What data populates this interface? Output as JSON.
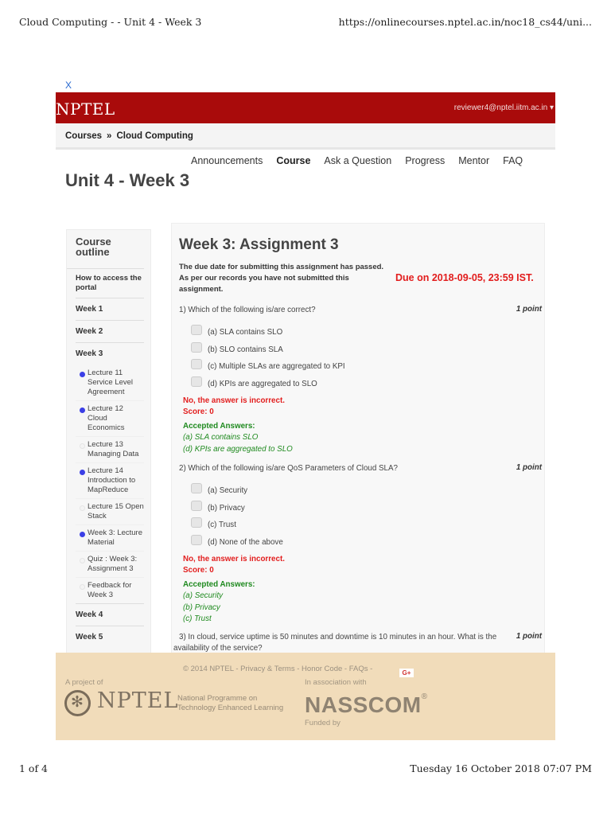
{
  "print": {
    "page_title": "Cloud Computing - - Unit 4 - Week 3",
    "url": "https://onlinecourses.nptel.ac.in/noc18_cs44/uni...",
    "page_count": "1 of 4",
    "printed_at": "Tuesday 16 October 2018 07:07 PM"
  },
  "close_label": "X",
  "topbar": {
    "logo": "NPTEL",
    "user": "reviewer4@nptel.iitm.ac.in ▾",
    "color": "#a90b0b"
  },
  "breadcrumb": {
    "items": [
      "Courses",
      "Cloud Computing"
    ],
    "separator": "»"
  },
  "nav": {
    "items": [
      {
        "label": "Announcements",
        "active": false
      },
      {
        "label": "Course",
        "active": true
      },
      {
        "label": "Ask a Question",
        "active": false
      },
      {
        "label": "Progress",
        "active": false
      },
      {
        "label": "Mentor",
        "active": false
      },
      {
        "label": "FAQ",
        "active": false
      }
    ]
  },
  "unit_title": "Unit 4 - Week 3",
  "sidebar": {
    "title_line1": "Course",
    "title_line2": "outline",
    "intro": "How to access the portal",
    "weeks_before": [
      "Week 1",
      "Week 2",
      "Week 3"
    ],
    "week3_items": [
      {
        "label": "Lecture 11 Service Level Agreement",
        "status": "done"
      },
      {
        "label": "Lecture 12 Cloud Economics",
        "status": "done"
      },
      {
        "label": "Lecture 13 Managing Data",
        "status": "pending"
      },
      {
        "label": "Lecture 14 Introduction to MapReduce",
        "status": "done"
      },
      {
        "label": "Lecture 15 Open Stack",
        "status": "pending"
      },
      {
        "label": "Week 3: Lecture Material",
        "status": "done"
      },
      {
        "label": "Quiz : Week 3: Assignment 3",
        "status": "pending"
      },
      {
        "label": "Feedback for Week 3",
        "status": "pending"
      }
    ],
    "weeks_after": [
      "Week 4",
      "Week 5"
    ]
  },
  "assignment": {
    "title": "Week 3: Assignment 3",
    "notice_line1": "The due date for submitting this assignment has passed.",
    "notice_line2": "As per our records you have not submitted this assignment.",
    "due": "Due on 2018-09-05, 23:59 IST.",
    "questions": [
      {
        "text": "1) Which of the following is/are correct?",
        "points": "1 point",
        "options": [
          "(a) SLA contains SLO",
          "(b) SLO contains SLA",
          "(c) Multiple SLAs are aggregated to KPI",
          "(d) KPIs are aggregated to SLO"
        ],
        "result": "No, the answer is incorrect.",
        "score": "Score: 0",
        "accepted_label": "Accepted Answers:",
        "accepted": [
          "(a) SLA contains SLO",
          "(d) KPIs are aggregated to SLO"
        ]
      },
      {
        "text": "2) Which of the following is/are QoS Parameters of Cloud SLA?",
        "points": "1 point",
        "options": [
          "(a) Security",
          "(b) Privacy",
          "(c) Trust",
          "(d) None of the above"
        ],
        "result": "No, the answer is incorrect.",
        "score": "Score: 0",
        "accepted_label": "Accepted Answers:",
        "accepted": [
          "(a) Security",
          "(b) Privacy",
          "(c) Trust"
        ]
      },
      {
        "text": "3) In cloud, service uptime is 50 minutes and downtime is 10 minutes in an hour. What is the availability of the service?",
        "points": "1 point"
      }
    ]
  },
  "footer": {
    "links": [
      "© 2014 NPTEL",
      "Privacy & Terms",
      "Honor Code",
      "FAQs"
    ],
    "gplus": "G+",
    "project_of": "A project of",
    "nptel_word": "NPTEL",
    "nptel_full": "National Programme on Technology Enhanced Learning",
    "in_association": "In association with",
    "nasscom": "NASSCOM",
    "nasscom_reg": "®",
    "funded_by": "Funded by"
  }
}
